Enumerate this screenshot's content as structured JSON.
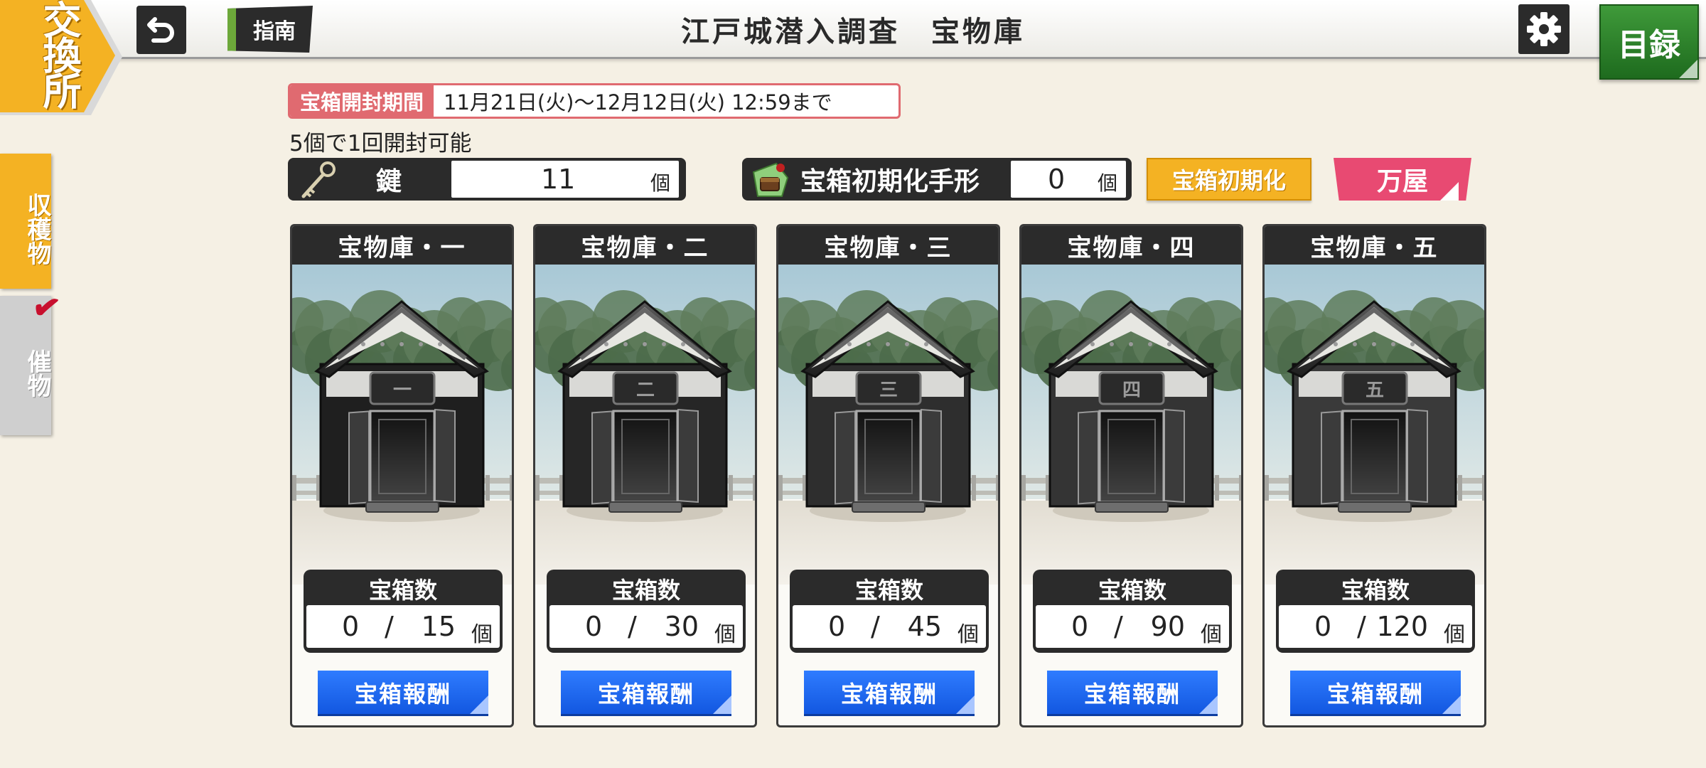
{
  "header": {
    "title": "江戸城潜入調査　宝物庫",
    "exchange_label": "交換所",
    "guide_label": "指南",
    "catalog_label": "目録"
  },
  "side_tabs": [
    {
      "label": "収穫物",
      "active": true
    },
    {
      "label": "催物",
      "active": false
    }
  ],
  "period": {
    "label": "宝箱開封期間",
    "value": "11月21日(火)〜12月12日(火) 12:59まで"
  },
  "open_note": "5個で1回開封可能",
  "key_counter": {
    "label": "鍵",
    "value": "11",
    "unit": "個"
  },
  "reset_counter": {
    "label": "宝箱初期化手形",
    "value": "0",
    "unit": "個"
  },
  "reset_button": "宝箱初期化",
  "shop_button": "万屋",
  "vaults": [
    {
      "title": "宝物庫・一",
      "plaque": "一",
      "count_label": "宝箱数",
      "current": "0",
      "slash": "/",
      "max": "15",
      "unit": "個",
      "reward_label": "宝箱報酬"
    },
    {
      "title": "宝物庫・二",
      "plaque": "二",
      "count_label": "宝箱数",
      "current": "0",
      "slash": "/",
      "max": "30",
      "unit": "個",
      "reward_label": "宝箱報酬"
    },
    {
      "title": "宝物庫・三",
      "plaque": "三",
      "count_label": "宝箱数",
      "current": "0",
      "slash": "/",
      "max": "45",
      "unit": "個",
      "reward_label": "宝箱報酬"
    },
    {
      "title": "宝物庫・四",
      "plaque": "四",
      "count_label": "宝箱数",
      "current": "0",
      "slash": "/",
      "max": "90",
      "unit": "個",
      "reward_label": "宝箱報酬"
    },
    {
      "title": "宝物庫・五",
      "plaque": "五",
      "count_label": "宝箱数",
      "current": "0",
      "slash": "/",
      "max": "120",
      "unit": "個",
      "reward_label": "宝箱報酬"
    }
  ],
  "colors": {
    "accent_orange": "#f4b223",
    "reward_blue": "#1f66f0",
    "shop_pink": "#e84a72",
    "catalog_green": "#2b8a2b",
    "period_red": "#e06a70"
  }
}
